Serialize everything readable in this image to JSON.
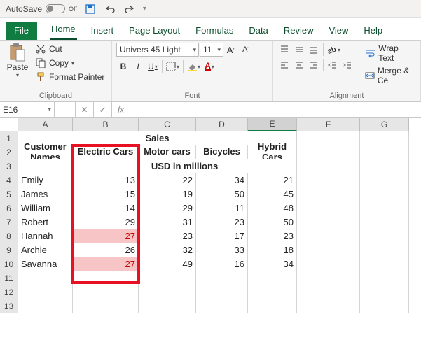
{
  "titlebar": {
    "autosave_label": "AutoSave",
    "autosave_state": "Off"
  },
  "tabs": {
    "file": "File",
    "home": "Home",
    "insert": "Insert",
    "page_layout": "Page Layout",
    "formulas": "Formulas",
    "data": "Data",
    "review": "Review",
    "view": "View",
    "help": "Help"
  },
  "ribbon": {
    "clipboard": {
      "label": "Clipboard",
      "paste": "Paste",
      "cut": "Cut",
      "copy": "Copy",
      "format_painter": "Format Painter"
    },
    "font": {
      "label": "Font",
      "name": "Univers 45 Light",
      "size": "11",
      "bold": "B",
      "italic": "I",
      "underline": "U"
    },
    "alignment": {
      "label": "Alignment",
      "wrap": "Wrap Text",
      "merge": "Merge & Ce"
    }
  },
  "formula": {
    "namebox": "E16",
    "fx_label": "fx"
  },
  "columns": [
    "A",
    "B",
    "C",
    "D",
    "E",
    "F",
    "G"
  ],
  "rows_hdr": [
    "1",
    "2",
    "3",
    "4",
    "5",
    "6",
    "7",
    "8",
    "9",
    "10",
    "11",
    "12",
    "13"
  ],
  "sheet": {
    "title": "Sales",
    "col_labels": [
      "Customer Names",
      "Electric Cars",
      "Motor cars",
      "Bicycles",
      "Hybrid Cars"
    ],
    "subtitle": "USD in millions",
    "rows": [
      {
        "name": "Emily",
        "b": "13",
        "c": "22",
        "d": "34",
        "e": "21"
      },
      {
        "name": "James",
        "b": "15",
        "c": "19",
        "d": "50",
        "e": "45"
      },
      {
        "name": "William",
        "b": "14",
        "c": "29",
        "d": "11",
        "e": "48"
      },
      {
        "name": "Robert",
        "b": "29",
        "c": "31",
        "d": "23",
        "e": "50"
      },
      {
        "name": "Hannah",
        "b": "27",
        "c": "23",
        "d": "17",
        "e": "23",
        "hl": true
      },
      {
        "name": "Archie",
        "b": "26",
        "c": "32",
        "d": "33",
        "e": "18"
      },
      {
        "name": "Savanna",
        "b": "27",
        "c": "49",
        "d": "16",
        "e": "34",
        "hl": true
      }
    ]
  },
  "chart_data": {
    "type": "table",
    "title": "Sales",
    "subtitle": "USD in millions",
    "columns": [
      "Customer Names",
      "Electric Cars",
      "Motor cars",
      "Bicycles",
      "Hybrid Cars"
    ],
    "rows": [
      [
        "Emily",
        13,
        22,
        34,
        21
      ],
      [
        "James",
        15,
        19,
        50,
        45
      ],
      [
        "William",
        14,
        29,
        11,
        48
      ],
      [
        "Robert",
        29,
        31,
        23,
        50
      ],
      [
        "Hannah",
        27,
        23,
        17,
        23
      ],
      [
        "Archie",
        26,
        32,
        33,
        18
      ],
      [
        "Savanna",
        27,
        49,
        16,
        34
      ]
    ]
  }
}
